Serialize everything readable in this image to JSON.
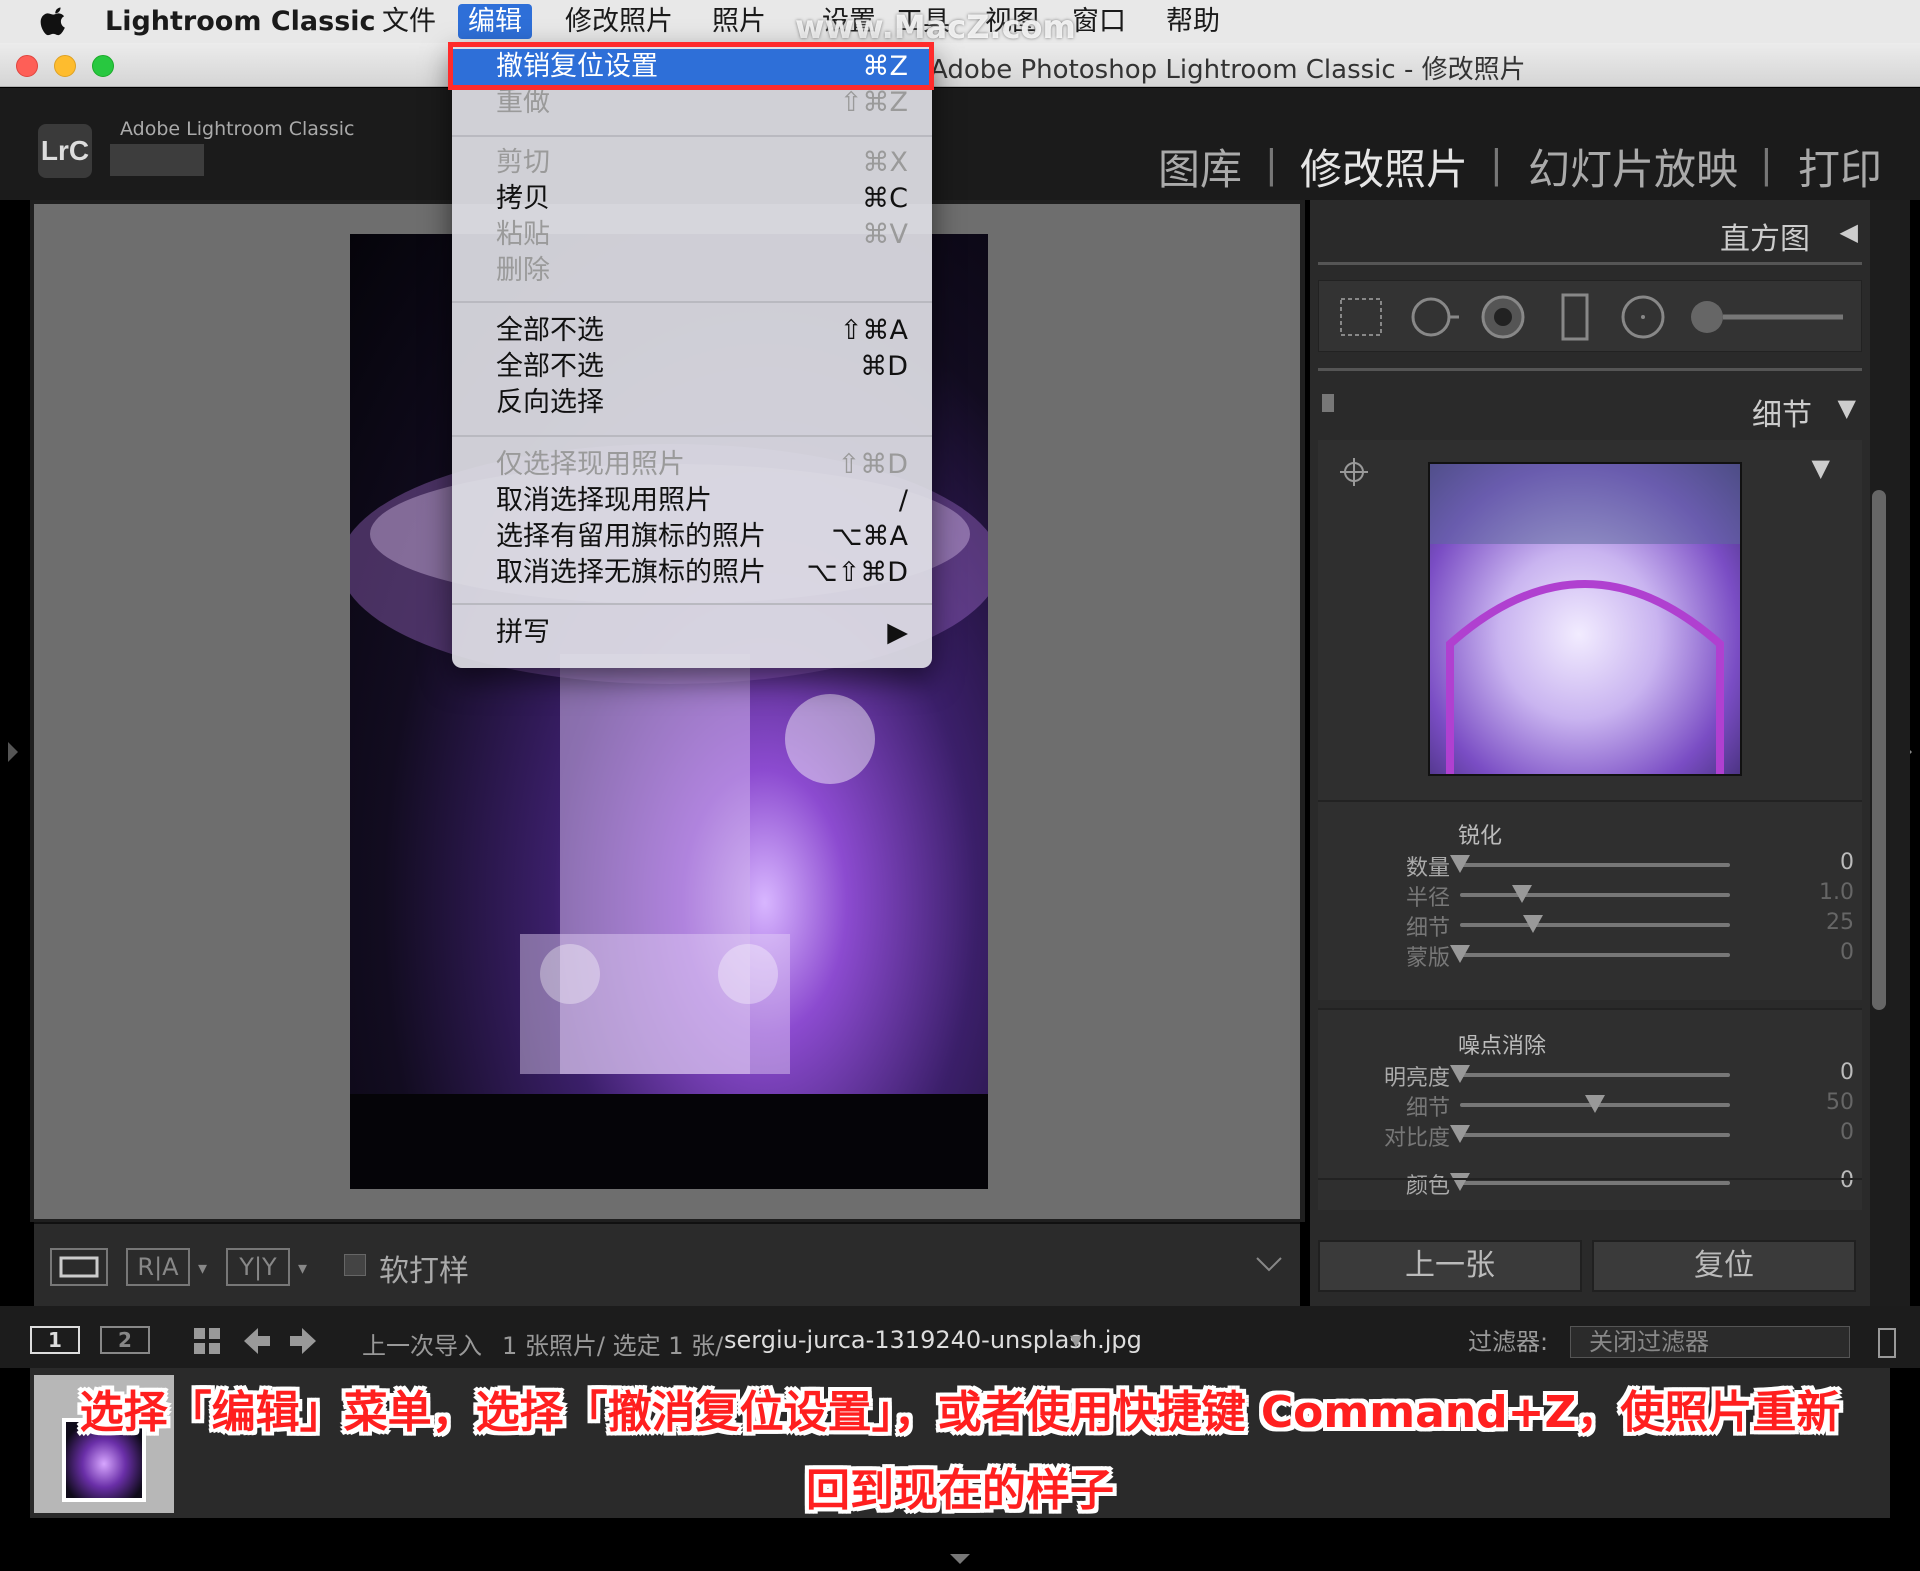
{
  "menubar": {
    "app_name": "Lightroom Classic",
    "items": [
      "文件",
      "编辑",
      "修改照片",
      "照片",
      "设置",
      "工具",
      "视图",
      "窗口",
      "帮助"
    ]
  },
  "watermark": "www.MacZ.com",
  "window": {
    "title": "Adobe Photoshop Lightroom Classic - 修改照片"
  },
  "lr_header": {
    "logo": "LrC",
    "brand": "Adobe Lightroom Classic",
    "modules": [
      "图库",
      "修改照片",
      "幻灯片放映",
      "打印"
    ]
  },
  "edit_menu": {
    "items": [
      {
        "label": "撤销复位设置",
        "shortcut": "⌘Z",
        "enabled": true,
        "highlighted": true
      },
      {
        "label": "重做",
        "shortcut": "⇧⌘Z",
        "enabled": false
      },
      {
        "label": "剪切",
        "shortcut": "⌘X",
        "enabled": false
      },
      {
        "label": "拷贝",
        "shortcut": "⌘C",
        "enabled": true
      },
      {
        "label": "粘贴",
        "shortcut": "⌘V",
        "enabled": false
      },
      {
        "label": "删除",
        "shortcut": "",
        "enabled": false
      },
      {
        "label": "全部不选",
        "shortcut": "⇧⌘A",
        "enabled": true
      },
      {
        "label": "全部不选",
        "shortcut": "⌘D",
        "enabled": true
      },
      {
        "label": "反向选择",
        "shortcut": "",
        "enabled": true
      },
      {
        "label": "仅选择现用照片",
        "shortcut": "⇧⌘D",
        "enabled": false
      },
      {
        "label": "取消选择现用照片",
        "shortcut": "/",
        "enabled": true
      },
      {
        "label": "选择有留用旗标的照片",
        "shortcut": "⌥⌘A",
        "enabled": true
      },
      {
        "label": "取消选择无旗标的照片",
        "shortcut": "⌥⇧⌘D",
        "enabled": true
      },
      {
        "label": "拼写",
        "shortcut": "▶",
        "enabled": true
      }
    ]
  },
  "right_panel": {
    "histogram_title": "直方图",
    "detail_title": "细节",
    "sharpening": {
      "title": "锐化",
      "sliders": [
        {
          "label": "数量",
          "value": "0",
          "position": 0.0,
          "active": true
        },
        {
          "label": "半径",
          "value": "1.0",
          "position": 0.23,
          "active": false
        },
        {
          "label": "细节",
          "value": "25",
          "position": 0.27,
          "active": false
        },
        {
          "label": "蒙版",
          "value": "0",
          "position": 0.0,
          "active": false
        }
      ]
    },
    "noise_reduction": {
      "title": "噪点消除",
      "sliders": [
        {
          "label": "明亮度",
          "value": "0",
          "position": 0.0,
          "active": true
        },
        {
          "label": "细节",
          "value": "50",
          "position": 0.5,
          "active": false
        },
        {
          "label": "对比度",
          "value": "0",
          "position": 0.0,
          "active": false
        },
        {
          "label": "颜色",
          "value": "0",
          "position": 0.0,
          "active": true
        }
      ]
    },
    "buttons": {
      "previous": "上一张",
      "reset": "复位"
    }
  },
  "toolbar": {
    "softproof": "软打样",
    "ra": "R|A",
    "yy": "Y|Y"
  },
  "filmstrip_bar": {
    "screen1": "1",
    "screen2": "2",
    "source": "上一次导入",
    "count": "1 张照片/ 选定 1 张/",
    "filename": "sergiu-jurca-1319240-unsplash.jpg",
    "filter_label": "过滤器:",
    "filter_value": "关闭过滤器"
  },
  "caption": {
    "line1": "选择「编辑」菜单，选择「撤消复位设置」，或者使用快捷键 Command+Z，使照片重新",
    "line2": "回到现在的样子"
  }
}
